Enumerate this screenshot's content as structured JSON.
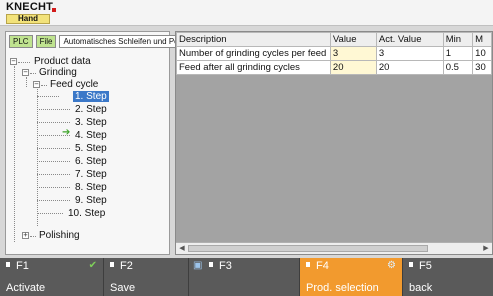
{
  "header": {
    "logo": "KNECHT",
    "mode": "Hand"
  },
  "filters": [
    {
      "label": "PLC",
      "color": "#bfe38f"
    },
    {
      "label": "File",
      "color": "#bfe38f"
    },
    {
      "label": "Automatisches Schleifen und Polieren",
      "color": "#ffffff"
    }
  ],
  "tree": {
    "root": "Product data",
    "grinding": "Grinding",
    "feed_cycle": "Feed cycle",
    "steps": [
      "1. Step",
      "2. Step",
      "3. Step",
      "4. Step",
      "5. Step",
      "6. Step",
      "7. Step",
      "8. Step",
      "9. Step",
      "10. Step"
    ],
    "selected_step": "1. Step",
    "polishing": "Polishing"
  },
  "table": {
    "columns": [
      "Description",
      "Value",
      "Act. Value",
      "Min",
      "M"
    ],
    "rows": [
      [
        "Number of grinding cycles per feed",
        "3",
        "3",
        "1",
        "10"
      ],
      [
        "Feed after all grinding cycles",
        "20",
        "20",
        "0.5",
        "30"
      ]
    ]
  },
  "function_keys": [
    {
      "key": "F1",
      "label": "Activate",
      "icon": "check-icon",
      "active": false
    },
    {
      "key": "F2",
      "label": "Save",
      "icon": "",
      "active": false
    },
    {
      "key": "F3",
      "label": "",
      "icon": "disk-icon",
      "active": false
    },
    {
      "key": "F4",
      "label": "Prod. selection",
      "icon": "gear-icon",
      "active": true
    },
    {
      "key": "F5",
      "label": "back",
      "icon": "",
      "active": false
    }
  ],
  "colors": {
    "accent": "#f29a2e",
    "selection": "#3b78c8",
    "function_bar": "#5a5a5a"
  }
}
